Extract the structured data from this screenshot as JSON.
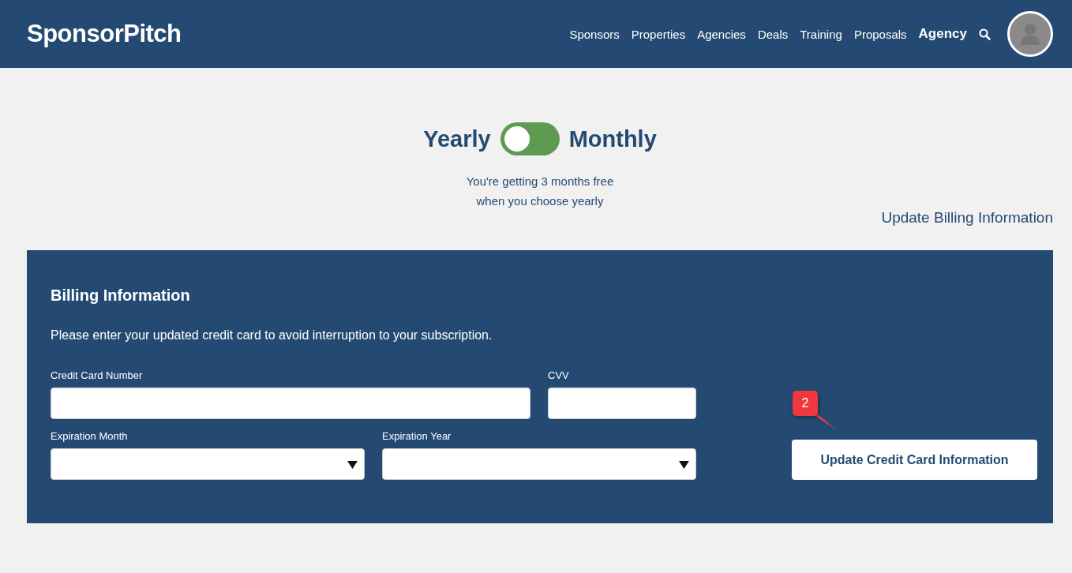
{
  "header": {
    "logo": "SponsorPitch",
    "nav": [
      {
        "label": "Sponsors",
        "kind": "link"
      },
      {
        "label": "Properties",
        "kind": "link"
      },
      {
        "label": "Agencies",
        "kind": "link"
      },
      {
        "label": "Deals",
        "kind": "link"
      },
      {
        "label": "Training",
        "kind": "link"
      },
      {
        "label": "Proposals",
        "kind": "link"
      },
      {
        "label": "Agency",
        "kind": "account"
      }
    ]
  },
  "plan_toggle": {
    "left_label": "Yearly",
    "right_label": "Monthly",
    "on": false,
    "note_lines": [
      "You're getting 3 months free",
      "when you choose yearly"
    ]
  },
  "update_billing_link": "Update Billing Information",
  "billing": {
    "title": "Billing Information",
    "description": "Please enter your updated credit card to avoid interruption to your subscription.",
    "fields": [
      {
        "label": "Credit Card Number",
        "kind": "text"
      },
      {
        "label": "CVV",
        "kind": "text"
      },
      {
        "label": "Expiration Month",
        "kind": "select"
      },
      {
        "label": "Expiration Year",
        "kind": "select"
      }
    ],
    "button": "Update Credit Card Information",
    "callout": "2"
  }
}
